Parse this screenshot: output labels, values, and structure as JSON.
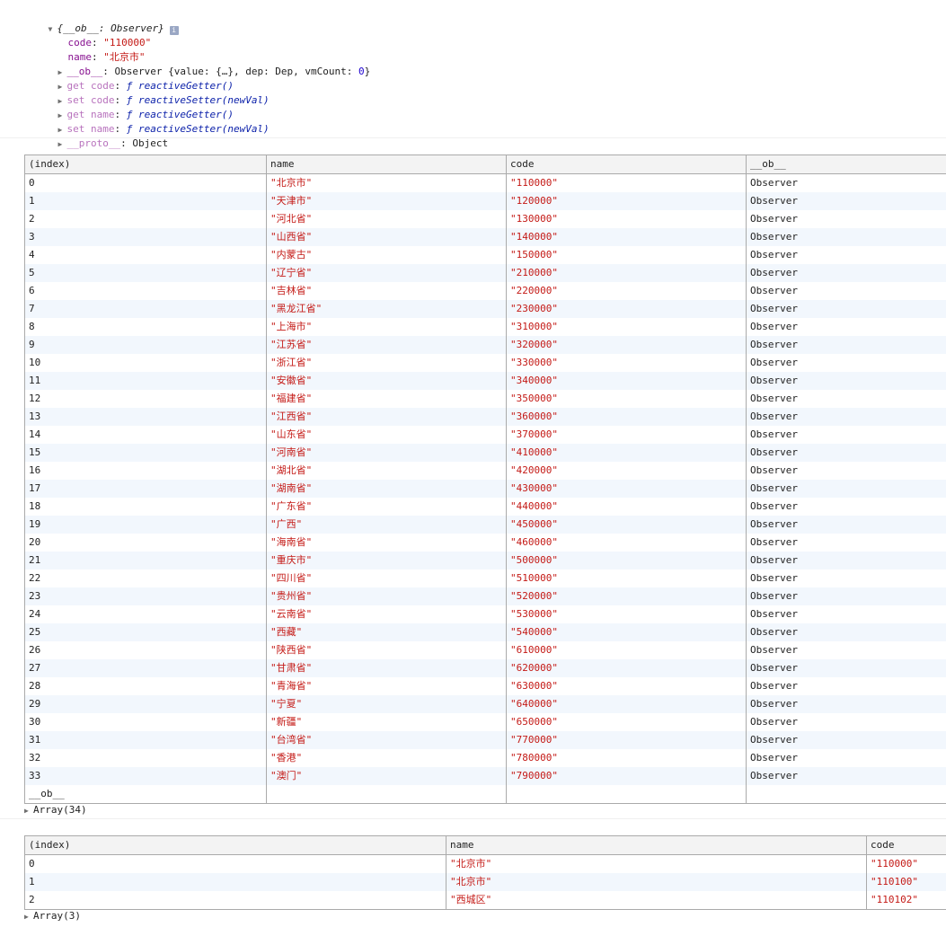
{
  "object_view": {
    "header": "{__ob__: Observer}",
    "code_key": "code",
    "code_value": "\"110000\"",
    "name_key": "name",
    "name_value": "\"北京市\"",
    "ob_key": "__ob__",
    "ob_value_prefix": "Observer {value: {…}, dep: Dep, vmCount: ",
    "ob_vmcount": "0",
    "ob_value_suffix": "}",
    "get_code_key": "get code",
    "get_code_fn": "reactiveGetter()",
    "set_code_key": "set code",
    "set_code_fn": "reactiveSetter(newVal)",
    "get_name_key": "get name",
    "get_name_fn": "reactiveGetter()",
    "set_name_key": "set name",
    "set_name_fn": "reactiveSetter(newVal)",
    "proto_key": "__proto__",
    "proto_value": "Object",
    "fn_glyph": "ƒ",
    "info_glyph": "i"
  },
  "table1": {
    "headers": [
      "(index)",
      "name",
      "code",
      "__ob__"
    ],
    "rows": [
      [
        "0",
        "\"北京市\"",
        "\"110000\"",
        "Observer"
      ],
      [
        "1",
        "\"天津市\"",
        "\"120000\"",
        "Observer"
      ],
      [
        "2",
        "\"河北省\"",
        "\"130000\"",
        "Observer"
      ],
      [
        "3",
        "\"山西省\"",
        "\"140000\"",
        "Observer"
      ],
      [
        "4",
        "\"内蒙古\"",
        "\"150000\"",
        "Observer"
      ],
      [
        "5",
        "\"辽宁省\"",
        "\"210000\"",
        "Observer"
      ],
      [
        "6",
        "\"吉林省\"",
        "\"220000\"",
        "Observer"
      ],
      [
        "7",
        "\"黑龙江省\"",
        "\"230000\"",
        "Observer"
      ],
      [
        "8",
        "\"上海市\"",
        "\"310000\"",
        "Observer"
      ],
      [
        "9",
        "\"江苏省\"",
        "\"320000\"",
        "Observer"
      ],
      [
        "10",
        "\"浙江省\"",
        "\"330000\"",
        "Observer"
      ],
      [
        "11",
        "\"安徽省\"",
        "\"340000\"",
        "Observer"
      ],
      [
        "12",
        "\"福建省\"",
        "\"350000\"",
        "Observer"
      ],
      [
        "13",
        "\"江西省\"",
        "\"360000\"",
        "Observer"
      ],
      [
        "14",
        "\"山东省\"",
        "\"370000\"",
        "Observer"
      ],
      [
        "15",
        "\"河南省\"",
        "\"410000\"",
        "Observer"
      ],
      [
        "16",
        "\"湖北省\"",
        "\"420000\"",
        "Observer"
      ],
      [
        "17",
        "\"湖南省\"",
        "\"430000\"",
        "Observer"
      ],
      [
        "18",
        "\"广东省\"",
        "\"440000\"",
        "Observer"
      ],
      [
        "19",
        "\"广西\"",
        "\"450000\"",
        "Observer"
      ],
      [
        "20",
        "\"海南省\"",
        "\"460000\"",
        "Observer"
      ],
      [
        "21",
        "\"重庆市\"",
        "\"500000\"",
        "Observer"
      ],
      [
        "22",
        "\"四川省\"",
        "\"510000\"",
        "Observer"
      ],
      [
        "23",
        "\"贵州省\"",
        "\"520000\"",
        "Observer"
      ],
      [
        "24",
        "\"云南省\"",
        "\"530000\"",
        "Observer"
      ],
      [
        "25",
        "\"西藏\"",
        "\"540000\"",
        "Observer"
      ],
      [
        "26",
        "\"陕西省\"",
        "\"610000\"",
        "Observer"
      ],
      [
        "27",
        "\"甘肃省\"",
        "\"620000\"",
        "Observer"
      ],
      [
        "28",
        "\"青海省\"",
        "\"630000\"",
        "Observer"
      ],
      [
        "29",
        "\"宁夏\"",
        "\"640000\"",
        "Observer"
      ],
      [
        "30",
        "\"新疆\"",
        "\"650000\"",
        "Observer"
      ],
      [
        "31",
        "\"台湾省\"",
        "\"770000\"",
        "Observer"
      ],
      [
        "32",
        "\"香港\"",
        "\"780000\"",
        "Observer"
      ],
      [
        "33",
        "\"澳门\"",
        "\"790000\"",
        "Observer"
      ],
      [
        "__ob__",
        "",
        "",
        ""
      ]
    ],
    "summary": "Array(34)"
  },
  "table2": {
    "headers": [
      "(index)",
      "name",
      "code"
    ],
    "rows": [
      [
        "0",
        "\"北京市\"",
        "\"110000\""
      ],
      [
        "1",
        "\"北京市\"",
        "\"110100\""
      ],
      [
        "2",
        "\"西城区\"",
        "\"110102\""
      ]
    ],
    "summary": "Array(3)"
  }
}
